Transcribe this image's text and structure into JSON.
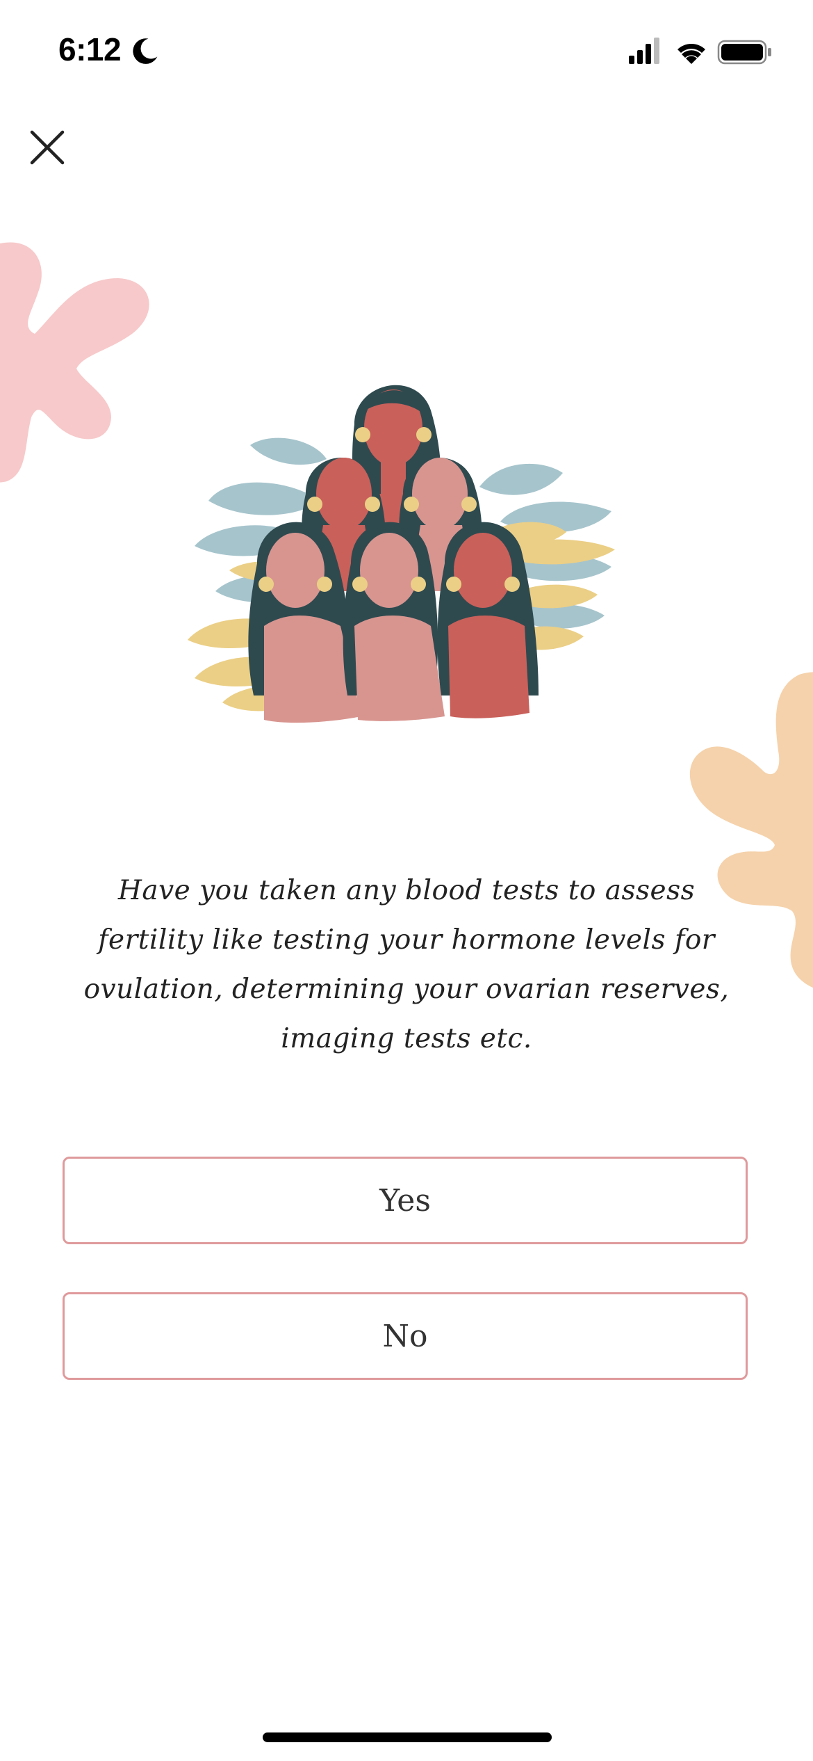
{
  "status_bar": {
    "time": "6:12"
  },
  "question": {
    "text": "Have you taken any blood tests to assess fertility like testing your hormone levels for ovulation, determining your ovarian reserves, imaging tests etc."
  },
  "options": {
    "yes_label": "Yes",
    "no_label": "No"
  },
  "icons": {
    "close": "close-icon",
    "moon": "moon-icon",
    "signal": "cellular-signal-icon",
    "wifi": "wifi-icon",
    "battery": "battery-icon"
  },
  "colors": {
    "option_border": "#df9a9c",
    "blob_left": "#f7c9ca",
    "blob_right": "#f5d2ab",
    "hair": "#2e4a4f",
    "leaf_blue": "#a6c4cc",
    "leaf_yellow": "#ebcf86"
  }
}
